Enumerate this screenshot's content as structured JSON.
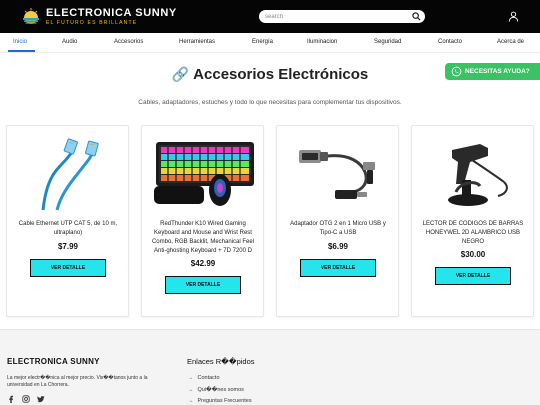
{
  "header": {
    "brand": "ELECTRONICA SUNNY",
    "tagline": "EL FUTURO ES BRILLANTE",
    "search_placeholder": "search",
    "colors": {
      "bar": "#050505",
      "tagline": "#f2c200"
    }
  },
  "nav": {
    "items": [
      {
        "label": "Inicio",
        "active": true
      },
      {
        "label": "Audio"
      },
      {
        "label": "Accesorios"
      },
      {
        "label": "Herramientas"
      },
      {
        "label": "Energía"
      },
      {
        "label": "Iluminacion"
      },
      {
        "label": "Seguridad"
      },
      {
        "label": "Contacto"
      },
      {
        "label": "Acerca de"
      }
    ],
    "accent": "#1a6bd8"
  },
  "hero": {
    "icon": "link-icon",
    "title": "Accesorios Electrónicos",
    "subtitle": "Cables, adaptadores, estuches y todo lo que necesitas para complementar tus dispositivos."
  },
  "whatsapp": {
    "label": "NECESITAS AYUDA?",
    "color": "#3ac364",
    "icon": "whatsapp-icon"
  },
  "products": [
    {
      "name": "Cable Ethernet UTP CAT 5, de 10 m, ultraplano)",
      "price": "$7.99",
      "button": "VER DETALLE",
      "image": "blue-ethernet-cable"
    },
    {
      "name": "RedThunder K10 Wired Gaming Keyboard and Mouse and Wrist Rest Combo, RGB Backlit, Mechanical Feel Anti-ghosting Keyboard + 7D 7200 D",
      "price": "$42.99",
      "button": "VER DETALLE",
      "image": "rgb-keyboard-mouse"
    },
    {
      "name": "Adaptador OTG 2 en 1 Micro USB y Tipo-C a USB",
      "price": "$6.99",
      "button": "VER DETALLE",
      "image": "otg-adapter"
    },
    {
      "name": "LECTOR DE CODIGOS DE BARRAS HONEYWEL 2D ALAMBRICO USB NEGRO",
      "price": "$30.00",
      "button": "VER DETALLE",
      "image": "barcode-scanner"
    }
  ],
  "button_color": "#25e4ec",
  "footer": {
    "brand": "ELECTRONICA SUNNY",
    "description": "La mejor electr��nica al mejor precio. Vis��tanos junto a la universidad en La Chorrera.",
    "social": [
      "facebook-icon",
      "instagram-icon",
      "twitter-icon"
    ],
    "links_title": "Enlaces R��pidos",
    "links": [
      "Contacto",
      "Qui��nes somos",
      "Preguntas Frecuentes"
    ]
  }
}
